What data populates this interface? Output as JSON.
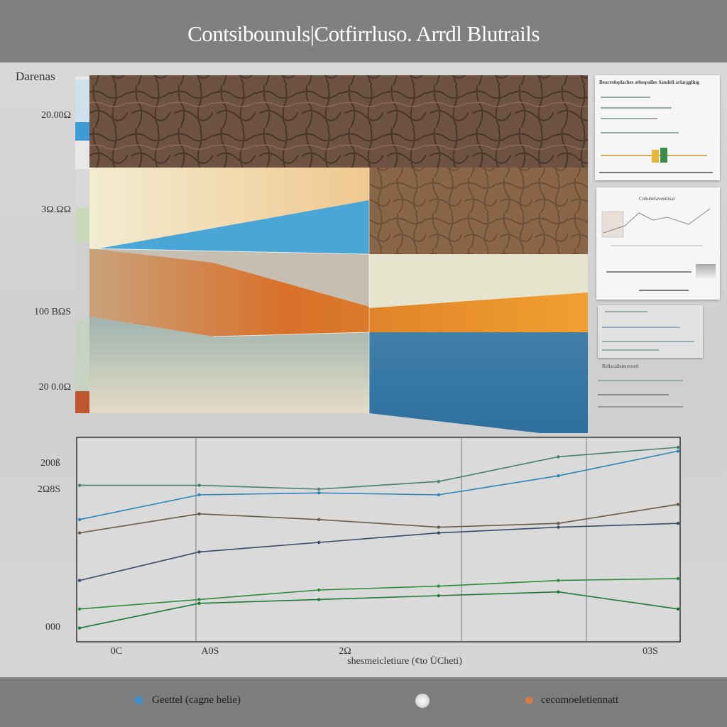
{
  "title": "Contsibounuls|Cotfirrluso. Arrdl Blutrails",
  "legend": {
    "items": [
      {
        "label": "Geettel (cagne helie)",
        "color": "#3a8fd0"
      },
      {
        "label": "",
        "color": "#bfc4c8"
      },
      {
        "label": "cecomoeletiennatt",
        "color": "#d07a4a"
      }
    ]
  },
  "colors": {
    "blue": "#4aa6d6",
    "orange": "#d9702a",
    "green": "#2e8b3e",
    "brown": "#8a6a4e"
  },
  "chart_data": [
    {
      "type": "area",
      "ylabel": "Darenas",
      "y_ticks": [
        "20.00Ω",
        "3Ω.ΩΩ",
        "100 BΩS",
        "20 0.0Ω"
      ],
      "series": [
        {
          "values": [
            0.6,
            0.75
          ]
        },
        {
          "values": [
            0.55,
            0.65,
            0.45
          ]
        },
        {
          "values": [
            0.5,
            0.4,
            0.35
          ]
        },
        {
          "values": [
            0.3,
            0.25,
            0.2
          ]
        }
      ]
    },
    {
      "type": "line",
      "y_ticks": [
        "200ß",
        "2Ω8S",
        "000"
      ],
      "x_ticks": [
        "0C",
        "A0S",
        "2Ω",
        "03S"
      ],
      "xlabel": "shesmeicletiure (¢to ÜCheti)",
      "grid": "vertical",
      "series": [
        {
          "values": [
            80,
            80,
            78,
            82,
            95,
            100
          ]
        },
        {
          "values": [
            62,
            75,
            76,
            75,
            85,
            98
          ]
        },
        {
          "values": [
            55,
            65,
            62,
            58,
            60,
            70
          ]
        },
        {
          "values": [
            30,
            45,
            50,
            55,
            58,
            60
          ]
        },
        {
          "values": [
            15,
            20,
            25,
            27,
            30,
            31
          ]
        },
        {
          "values": [
            5,
            18,
            20,
            22,
            24,
            15
          ]
        }
      ]
    }
  ],
  "thumbnails": [
    {
      "caption": "Bearroloplaches atluspalles Sandeli arlarggling"
    },
    {
      "caption": "Cohubelavenitisat"
    },
    {
      "caption": "Rellacallsieuvsterl"
    }
  ]
}
